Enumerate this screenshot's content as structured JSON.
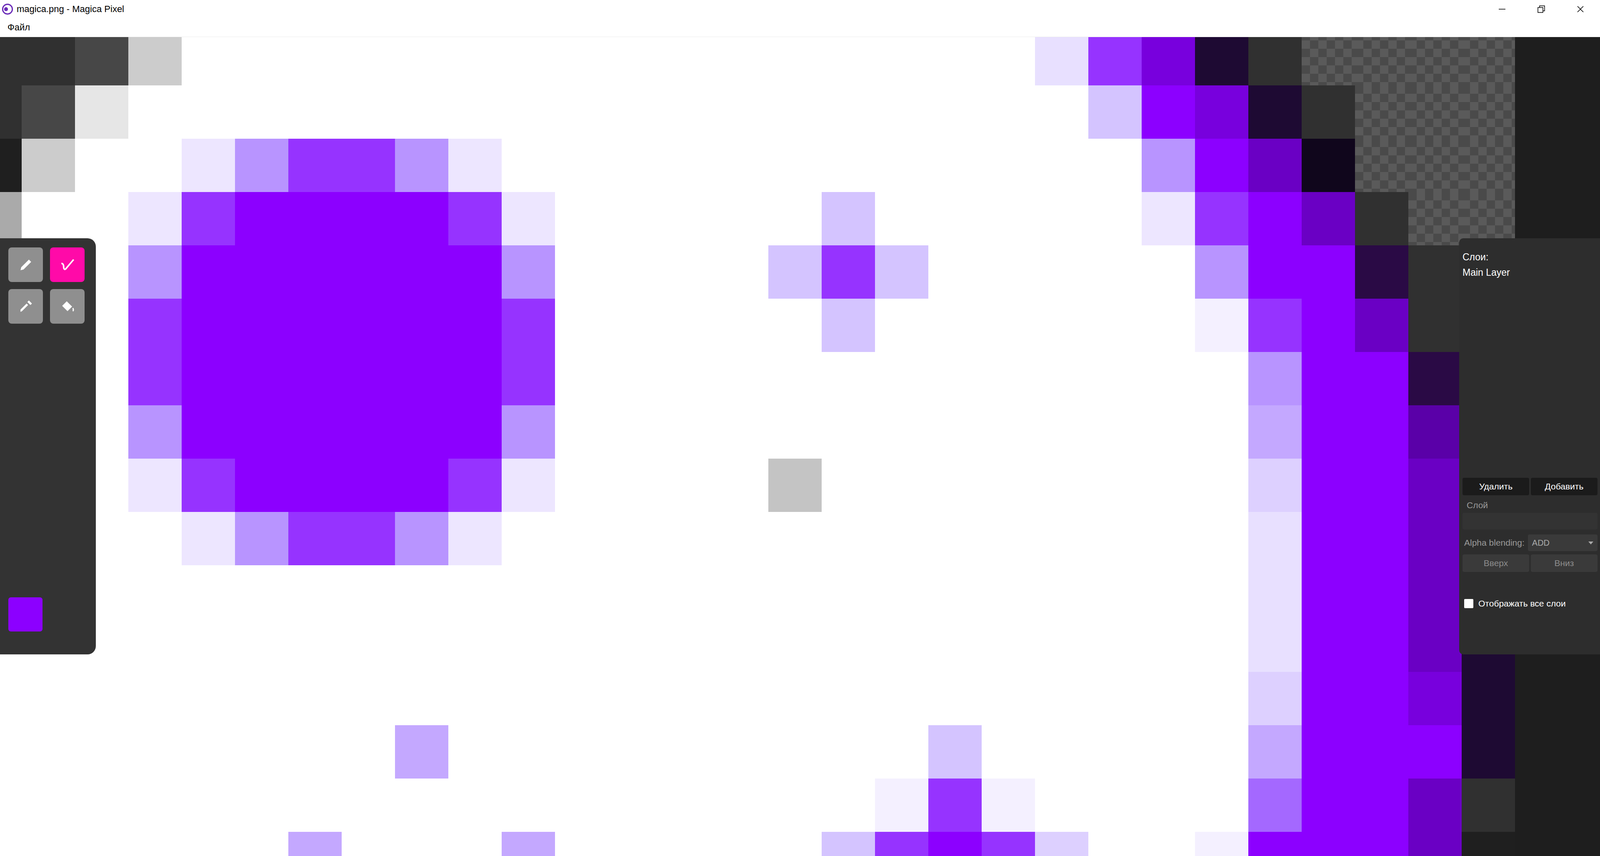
{
  "window": {
    "title": "magica.png - Magica Pixel"
  },
  "menu": [
    {
      "label": "Файл"
    }
  ],
  "tools": [
    {
      "kind": "pencil",
      "selected": false
    },
    {
      "kind": "brush",
      "selected": true
    },
    {
      "kind": "picker",
      "selected": false
    },
    {
      "kind": "fill",
      "selected": false
    }
  ],
  "current_color": "#8c00ff",
  "canvas": {
    "palette": {
      "w": "#ffffff",
      "t": null,
      "k": "#303030",
      "g": "#474747",
      "l": "#cccccc",
      "e": "#e6e6e6",
      "d": "#1f1f1f",
      "s": "#aaaaaa",
      "y": "#c4c4c4",
      "a": "#8c00ff",
      "b": "#9633ff",
      "m": "#b894ff",
      "c": "#d4c4ff",
      "q": "#ede6ff",
      "f": "#f4f0ff",
      "p": "#e8e0ff",
      "h": "#ddd0ff",
      "j": "#c4a8ff",
      "n": "#a468ff",
      "v": "#7800dd",
      "u": "#1e0a33",
      "x": "#6a00c4",
      "z": "#10061c",
      "o": "#2a0a45",
      "r": "#5a00a8"
    },
    "rows": [
      "kkglwwwwwwwwwwwwwwwwpbvuktttt",
      "kgewwwwwwwwwwwwwwwwwwcavukttt",
      "dlwwqmbbmqwwwwwwwwwwwwmaxzttt",
      "swwqbaaaabqwwwwwcwwwwwqbaxktt",
      "wwwmaaaaaamwwwwcbcwwwwwmaaokt",
      "wwwbaaaaaabwwwwwcwwwwwwfbaxkk",
      "wwwbaaaaaabwwwwwwwwwwwwwmaaok",
      "wwwmaaaaaamwwwwwwwwwwwwwjaard",
      "wwwqbaaaabqwwwwywwwwwwwwhaaxd",
      "wwwwqmbbmqwwwwwwwwwwwwwwpaaxd",
      "wwwwwwwwwwwwwwwwwwwwwwwwpaaxd",
      "wwwwwwwwwwwwwwwwwwwwwwwwpaaxu",
      "wwwwwwwwwwwwwwwwwwwwwwwwhaavu",
      "wwwwwwwwjwwwwwwwwwcwwwwwjaaau",
      "wwwwwwwwwwwwwwwwwfbfwwwwnaaxk",
      "wwwwwwjwwwjwwwwwcbabhwwfaaaxd"
    ]
  },
  "layers_panel": {
    "title": "Слои:",
    "layers": [
      {
        "name": "Main Layer",
        "selected": false
      }
    ],
    "buttons": [
      "Удалить",
      "Добавить"
    ],
    "layer_label": "Слой",
    "layer_name": "",
    "alpha_label": "Alpha blending:",
    "alpha_value": "ADD",
    "order_buttons": [
      {
        "label": "Вверх",
        "disabled": true
      },
      {
        "label": "Вниз",
        "disabled": true
      }
    ],
    "show_all": {
      "label": "Отображать все слои",
      "checked": false
    }
  }
}
